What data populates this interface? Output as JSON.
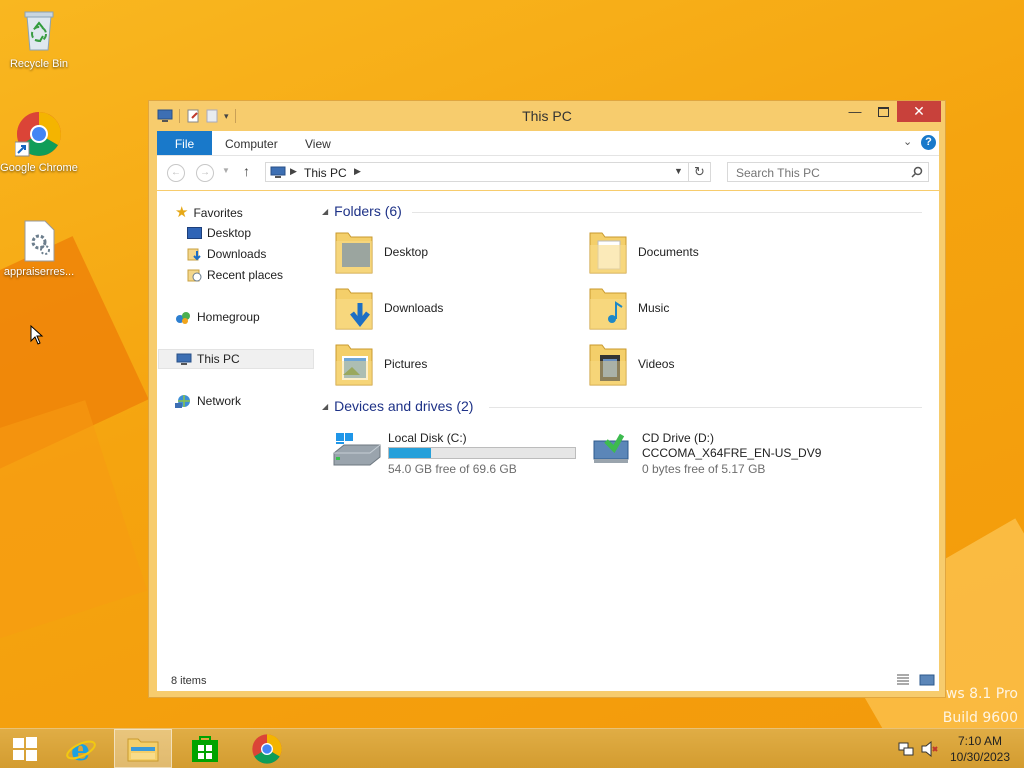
{
  "desktop": {
    "icons": [
      {
        "label": "Recycle Bin",
        "icon": "recycle-bin-icon"
      },
      {
        "label": "Google Chrome",
        "icon": "chrome-icon"
      },
      {
        "label": "appraiserres...",
        "icon": "config-file-icon"
      }
    ],
    "watermark": [
      "ws 8.1 Pro",
      "Build 9600"
    ]
  },
  "window": {
    "title": "This PC",
    "ribbon_tabs": [
      "File",
      "Computer",
      "View"
    ],
    "address": {
      "location": "This PC"
    },
    "search": {
      "placeholder": "Search This PC"
    },
    "sidebar": {
      "favorites_label": "Favorites",
      "favorites": [
        "Desktop",
        "Downloads",
        "Recent places"
      ],
      "homegroup": "Homegroup",
      "this_pc": "This PC",
      "network": "Network"
    },
    "folders_header": "Folders (6)",
    "folders": [
      "Desktop",
      "Documents",
      "Downloads",
      "Music",
      "Pictures",
      "Videos"
    ],
    "devices_header": "Devices and drives (2)",
    "drives": [
      {
        "name": "Local Disk (C:)",
        "free_text": "54.0 GB free of 69.6 GB",
        "used_fraction": 0.224
      },
      {
        "name": "CD Drive (D:)",
        "label": "CCCOMA_X64FRE_EN-US_DV9",
        "free_text": "0 bytes free of 5.17 GB"
      }
    ],
    "status": "8 items"
  },
  "taskbar": {
    "apps": [
      "start-button",
      "internet-explorer",
      "file-explorer",
      "store",
      "chrome"
    ],
    "time": "7:10 AM",
    "date": "10/30/2023"
  },
  "colors": {
    "accent": "#1979ca",
    "close": "#c8413b",
    "window_frame": "#f7cc6d",
    "desktop": "#f6a91a"
  }
}
